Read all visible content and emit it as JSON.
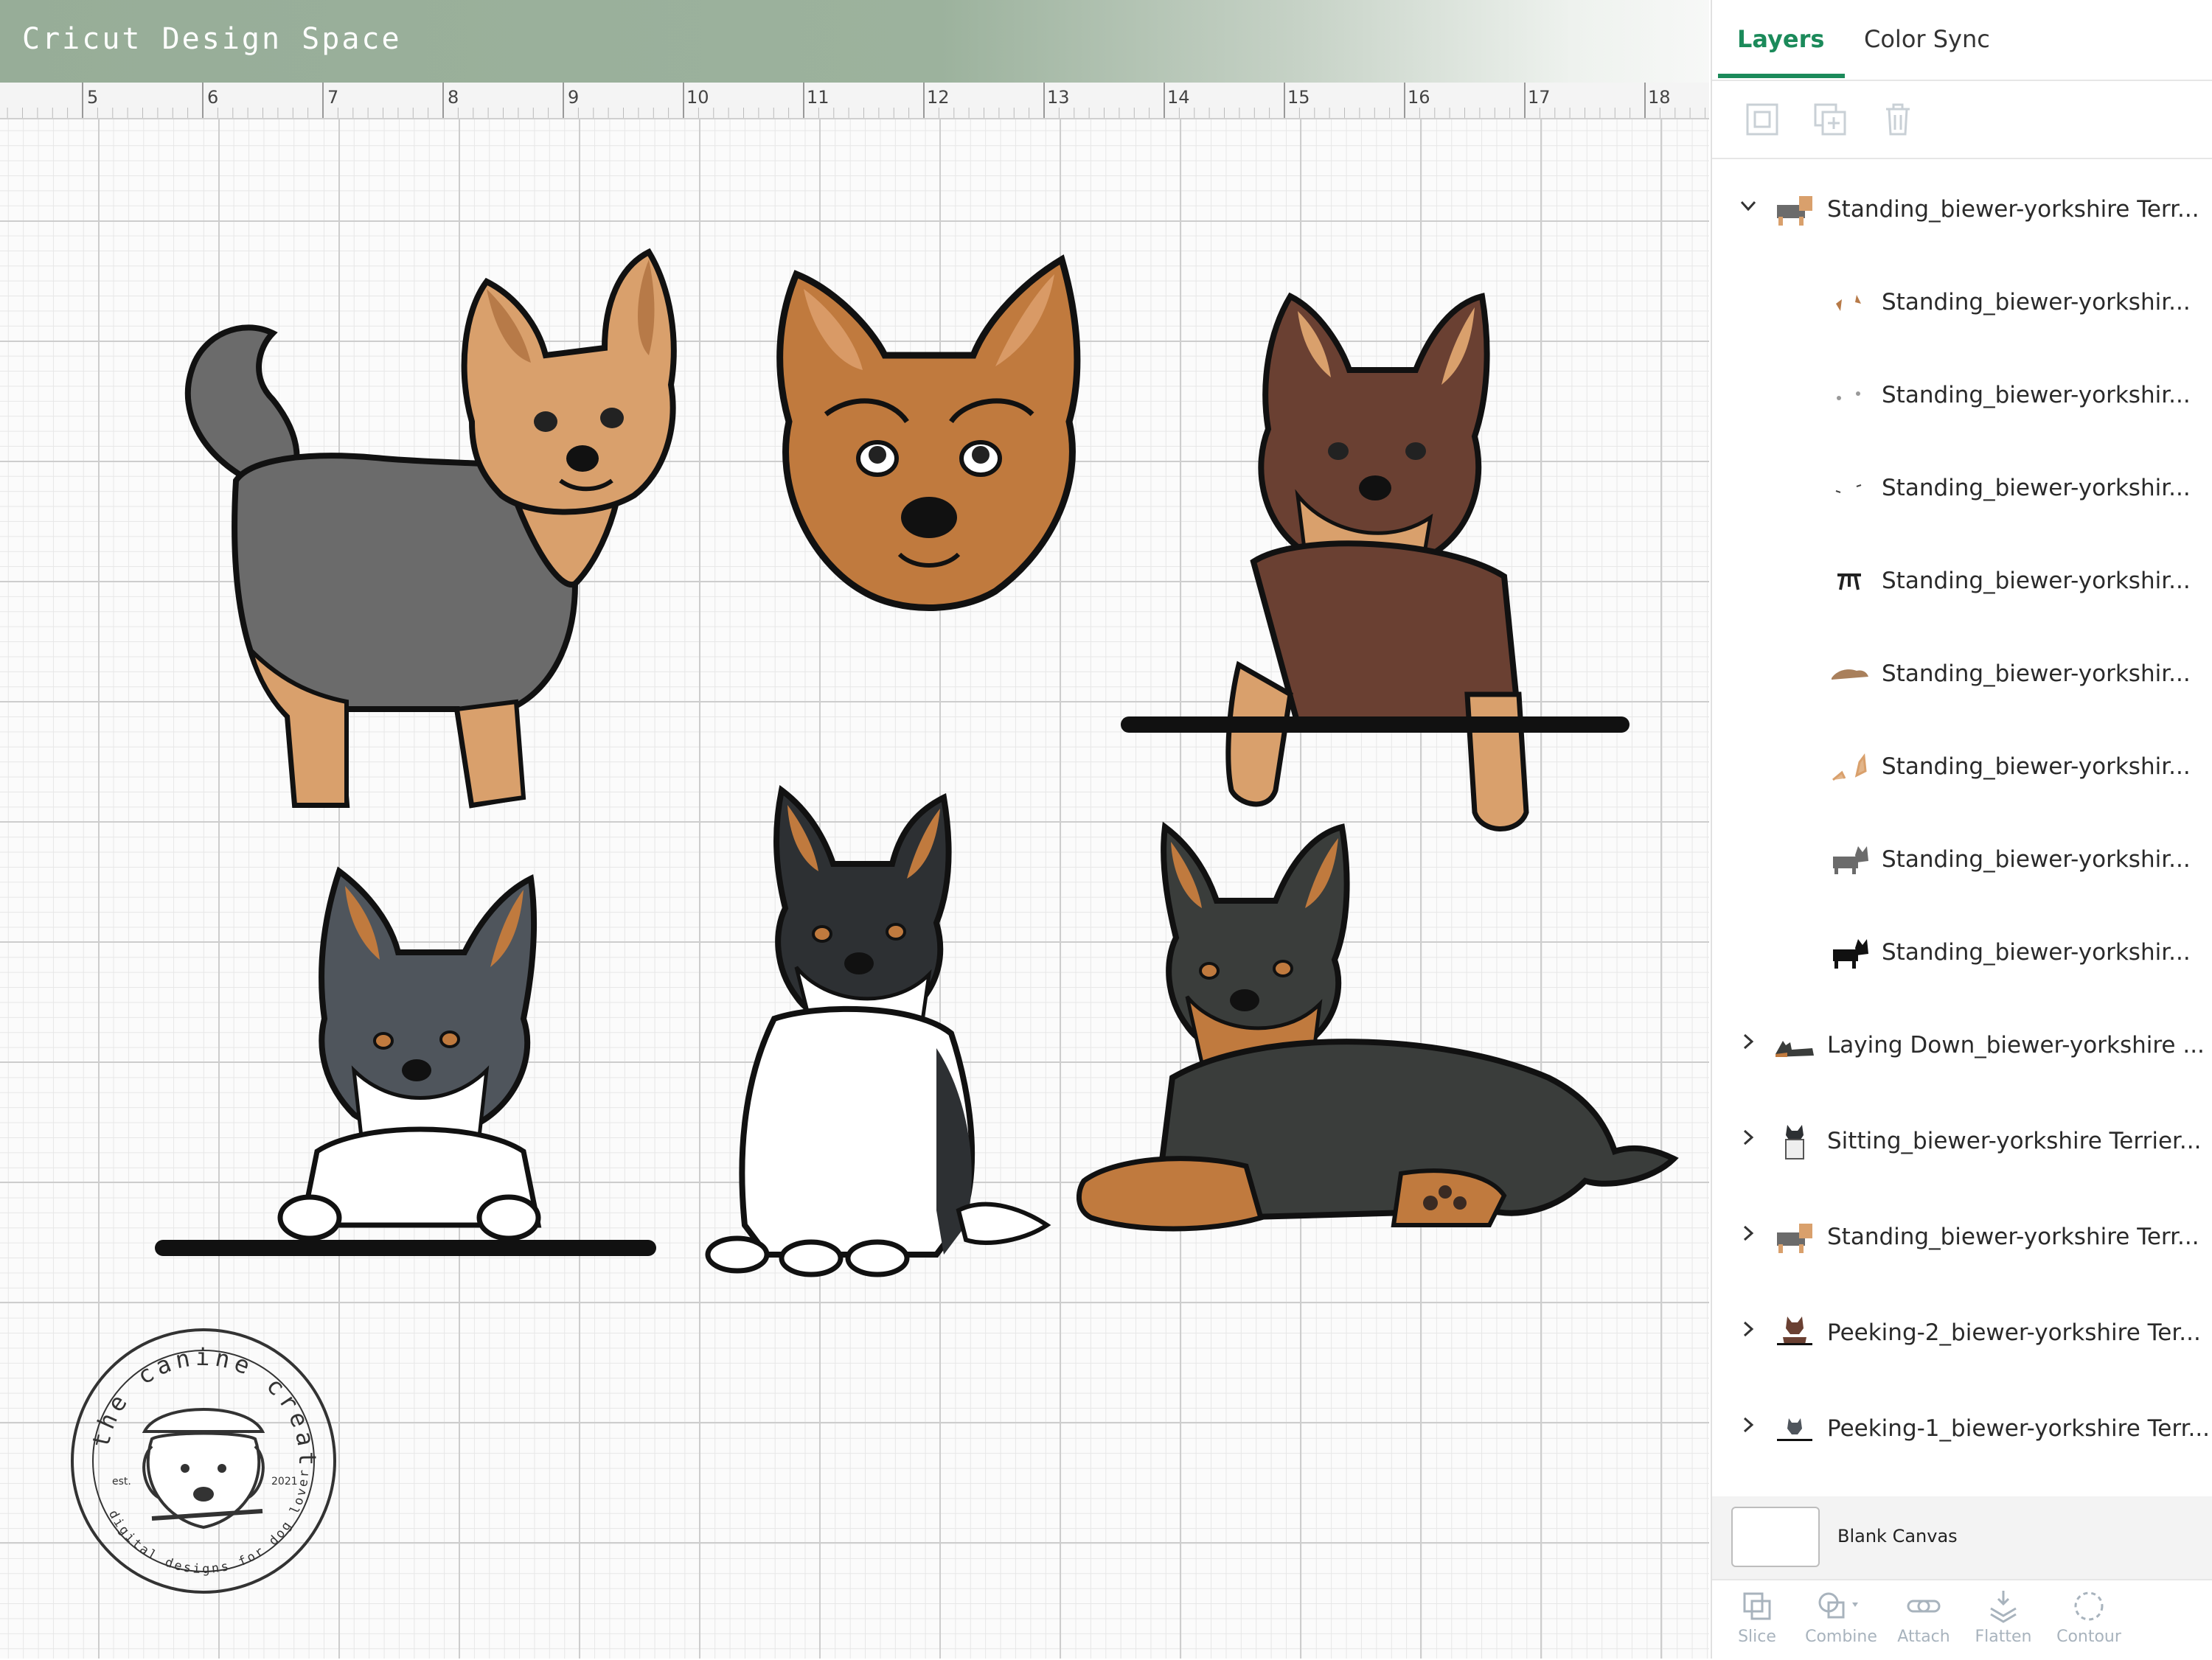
{
  "app": {
    "title": "Cricut Design Space"
  },
  "ruler": {
    "labels": [
      "5",
      "6",
      "7",
      "8",
      "9",
      "10",
      "11",
      "12",
      "13",
      "14",
      "15",
      "16",
      "17",
      "18"
    ]
  },
  "panel": {
    "tabs": [
      {
        "label": "Layers",
        "active": true
      },
      {
        "label": "Color Sync",
        "active": false
      }
    ],
    "toolbar": [
      "group-icon",
      "duplicate-icon",
      "delete-icon"
    ],
    "layers": [
      {
        "label": "Standing_biewer-yorkshire Terr...",
        "expanded": true,
        "level": 0
      },
      {
        "label": "Standing_biewer-yorkshir...",
        "level": 1
      },
      {
        "label": "Standing_biewer-yorkshir...",
        "level": 1
      },
      {
        "label": "Standing_biewer-yorkshir...",
        "level": 1
      },
      {
        "label": "Standing_biewer-yorkshir...",
        "level": 1
      },
      {
        "label": "Standing_biewer-yorkshir...",
        "level": 1
      },
      {
        "label": "Standing_biewer-yorkshir...",
        "level": 1
      },
      {
        "label": "Standing_biewer-yorkshir...",
        "level": 1
      },
      {
        "label": "Standing_biewer-yorkshir...",
        "level": 1
      },
      {
        "label": "Laying Down_biewer-yorkshire ...",
        "expanded": false,
        "level": 0
      },
      {
        "label": "Sitting_biewer-yorkshire Terrier...",
        "expanded": false,
        "level": 0
      },
      {
        "label": "Standing_biewer-yorkshire Terr...",
        "expanded": false,
        "level": 0
      },
      {
        "label": "Peeking-2_biewer-yorkshire Ter...",
        "expanded": false,
        "level": 0
      },
      {
        "label": "Peeking-1_biewer-yorkshire Terr...",
        "expanded": false,
        "level": 0
      }
    ],
    "blank_canvas": {
      "label": "Blank Canvas"
    },
    "actions": [
      {
        "label": "Slice",
        "icon": "slice-icon"
      },
      {
        "label": "Combine",
        "icon": "combine-icon"
      },
      {
        "label": "Attach",
        "icon": "attach-icon"
      },
      {
        "label": "Flatten",
        "icon": "flatten-icon"
      },
      {
        "label": "Contour",
        "icon": "contour-icon"
      }
    ]
  },
  "watermark": {
    "top_text": "the canine creative",
    "bottom_text": "digital designs for dog lovers",
    "est_label": "est.",
    "year": "2021"
  },
  "colors": {
    "accent": "#1b8a5a",
    "header": "#9cb29d",
    "tan": "#d9a06c",
    "rust": "#c07a3e",
    "grey": "#6b6b6b",
    "brown": "#6a4032"
  }
}
